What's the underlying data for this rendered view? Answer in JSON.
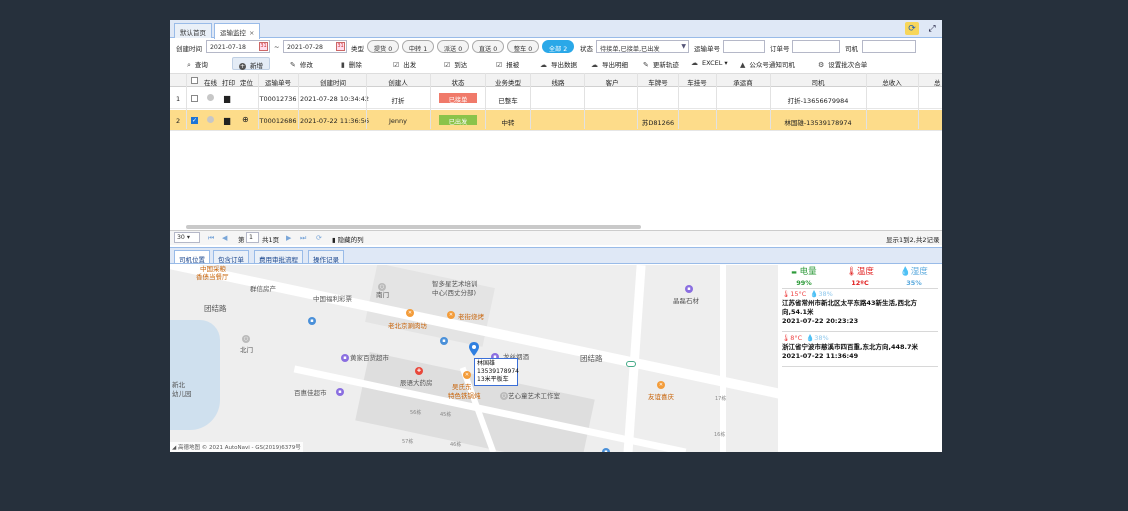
{
  "tabs": [
    {
      "label": "默认首页"
    },
    {
      "label": "运输监控",
      "close": "×"
    }
  ],
  "window_controls": {
    "refresh": "⟳",
    "fullscreen": "⤢"
  },
  "filters": {
    "create_time_label": "创建时间",
    "date_from": "2021-07-18",
    "tilde": "~",
    "date_to": "2021-07-28",
    "type_label": "类型",
    "type_pills": [
      {
        "label": "提货 0"
      },
      {
        "label": "中转 1"
      },
      {
        "label": "派送 0"
      },
      {
        "label": "直送 0"
      },
      {
        "label": "整车 0"
      },
      {
        "label": "全部 2"
      }
    ],
    "status_label": "状态",
    "status_value": "待接单,已接单,已出发",
    "waybill_label": "运输单号",
    "order_label": "订单号",
    "driver_label": "司机"
  },
  "toolbar": [
    {
      "icon": "search-icon",
      "glyph": "🔍",
      "label": "查询"
    },
    {
      "icon": "add-icon",
      "glyph": "+",
      "label": "新增"
    },
    {
      "icon": "edit-icon",
      "glyph": "✎",
      "label": "修改"
    },
    {
      "icon": "delete-icon",
      "glyph": "🗑",
      "label": "删除"
    },
    {
      "icon": "checkbox-icon",
      "glyph": "☑",
      "label": "出发"
    },
    {
      "icon": "checkbox-icon",
      "glyph": "☑",
      "label": "到达"
    },
    {
      "icon": "checkbox-icon",
      "glyph": "☑",
      "label": "报被"
    },
    {
      "icon": "cloud-download-icon",
      "glyph": "☁",
      "label": "导出数据"
    },
    {
      "icon": "cloud-download-icon",
      "glyph": "☁",
      "label": "导出明细"
    },
    {
      "icon": "refresh-track-icon",
      "glyph": "✎",
      "label": "更新轨迹"
    },
    {
      "icon": "excel-icon",
      "glyph": "☁",
      "label": "EXCEL ▾"
    },
    {
      "icon": "bell-icon",
      "glyph": "🔔",
      "label": "公众号通知司机"
    },
    {
      "icon": "settings-icon",
      "glyph": "⚙",
      "label": "设置批次合单"
    }
  ],
  "grid": {
    "headers": [
      "在线",
      "打印",
      "定位",
      "运输单号",
      "创建时间",
      "创建人",
      "状态",
      "业务类型",
      "线路",
      "客户",
      "车牌号",
      "车挂号",
      "承运商",
      "司机",
      "总收入",
      "总"
    ],
    "rows": [
      {
        "num": "1",
        "checked": false,
        "waybill": "T00012736",
        "created": "2021-07-28 10:34:42",
        "creator": "打折",
        "status": "已接单",
        "status_color": "#f07a6a",
        "biz": "已整车",
        "plate": "",
        "driver": "打折-13656679984"
      },
      {
        "num": "2",
        "checked": true,
        "waybill": "T00012686",
        "created": "2021-07-22 11:36:56",
        "creator": "Jenny",
        "status": "已出发",
        "status_color": "#8bc34a",
        "biz": "中转",
        "plate": "苏D81266",
        "driver": "林国雄-13539178974"
      }
    ]
  },
  "pager": {
    "page_size": "30 ▾",
    "page_prefix": "第",
    "page_value": "1",
    "page_suffix": "共1页",
    "hidden_cols": "隐藏的列",
    "summary": "显示1到2,共2记录"
  },
  "bottom_tabs": [
    {
      "label": "司机位置"
    },
    {
      "label": "包含订单"
    },
    {
      "label": "费用审批流程"
    },
    {
      "label": "操作记录"
    }
  ],
  "map": {
    "labels": {
      "l1": "中国采粮",
      "l2": "香债当餐厅",
      "l3": "群信房产",
      "l4": "中国福利彩票",
      "l5": "南门",
      "l6": "智多星艺术培训",
      "l7": "中心(西丈分部)",
      "l8": "团结路",
      "l9": "老北京涮肉坊",
      "l10": "老街烧烤",
      "l11": "北门",
      "l12": "黄家百货超市",
      "l13": "龙丝烟酒",
      "l14": "团结路",
      "l15": "晶磊石材",
      "l16": "辰语大药房",
      "l17": "吴氏东",
      "l18": "特色铁锅炖",
      "l19": "艺心童艺术工作室",
      "l20": "友谊喜庆",
      "l21": "新北",
      "l22": "幼儿园",
      "l23": "百惠佳超市",
      "l24": "17栋",
      "l25": "16栋",
      "l26": "56栋",
      "l27": "45栋",
      "l28": "57栋",
      "l29": "46栋"
    },
    "info_lines": [
      "林国雄",
      "13539178974",
      "13米平板车"
    ],
    "copyright": "◢ 高德地图 © 2021 AutoNavi - GS(2019)6379号"
  },
  "side": {
    "stats": [
      {
        "title": "电量",
        "value": "99%",
        "color": "#2e9a3a",
        "icon": "▬"
      },
      {
        "title": "温度",
        "value": "12ºC",
        "color": "#e02020",
        "icon": "🌡"
      },
      {
        "title": "湿度",
        "value": "35%",
        "color": "#5aa9dd",
        "icon": "💧"
      }
    ],
    "events": [
      {
        "temp": "🌡15°C",
        "hum": "💧38%",
        "addr": "江苏省常州市新北区太平东路43新生活,西北方向,54.1米",
        "time": "2021-07-22 20:23:23"
      },
      {
        "temp": "🌡8°C",
        "hum": "💧38%",
        "addr": "浙江省宁波市慈溪市四百重,东北方向,448.7米",
        "time": "2021-07-22 11:36:49"
      }
    ]
  }
}
